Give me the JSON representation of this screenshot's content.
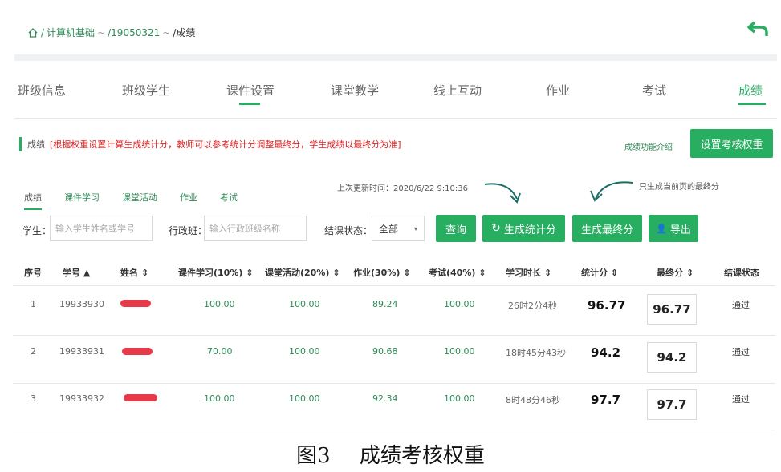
{
  "breadcrumb": {
    "root": "/",
    "course": "计算机基础",
    "arrow1": "~",
    "class": "/19050321",
    "arrow2": "~",
    "current": "/成绩"
  },
  "tabs": [
    "班级信息",
    "班级学生",
    "课件设置",
    "课堂教学",
    "线上互动",
    "作业",
    "考试",
    "成绩"
  ],
  "notice": {
    "label": "成绩",
    "hint": "[根据权重设置计算生成统计分，教师可以参考统计分调整最终分，学生成绩以最终分为准]",
    "intro_link": "成绩功能介绍",
    "weight_button": "设置考核权重"
  },
  "subtabs": [
    "成绩",
    "课件学习",
    "课堂活动",
    "作业",
    "考试"
  ],
  "update_time": "上次更新时间：2020/6/22 9:10:36",
  "only_note": "只生成当前页的最终分",
  "filters": {
    "student_label": "学生：",
    "student_placeholder": "输入学生姓名或学号",
    "class_label": "行政班：",
    "class_placeholder": "输入行政班级名称",
    "status_label": "结课状态：",
    "status_value": "全部"
  },
  "buttons": {
    "query": "查询",
    "gen_stat": "生成统计分",
    "gen_final": "生成最终分",
    "export": "导出"
  },
  "table": {
    "headers": [
      "序号",
      "学号 ▲",
      "姓名 ⇕",
      "课件学习(10%) ⇕",
      "课堂活动(20%) ⇕",
      "作业(30%) ⇕",
      "考试(40%) ⇕",
      "学习时长 ⇕",
      "统计分 ⇕",
      "最终分 ⇕",
      "结课状态"
    ],
    "rows": [
      {
        "no": "1",
        "id": "19933930",
        "courseware": "100.00",
        "activity": "100.00",
        "homework": "89.24",
        "exam": "100.00",
        "duration": "26时2分4秒",
        "stat": "96.77",
        "final": "96.77",
        "status": "通过"
      },
      {
        "no": "2",
        "id": "19933931",
        "courseware": "70.00",
        "activity": "100.00",
        "homework": "90.68",
        "exam": "100.00",
        "duration": "18时45分43秒",
        "stat": "94.2",
        "final": "94.2",
        "status": "通过"
      },
      {
        "no": "3",
        "id": "19933932",
        "courseware": "100.00",
        "activity": "100.00",
        "homework": "92.34",
        "exam": "100.00",
        "duration": "8时48分46秒",
        "stat": "97.7",
        "final": "97.7",
        "status": "通过"
      }
    ]
  },
  "caption": {
    "fig": "图3",
    "title": "成绩考核权重"
  },
  "colors": {
    "accent": "#27ae60",
    "hint": "#e02020",
    "redaction": "#e8394a"
  }
}
